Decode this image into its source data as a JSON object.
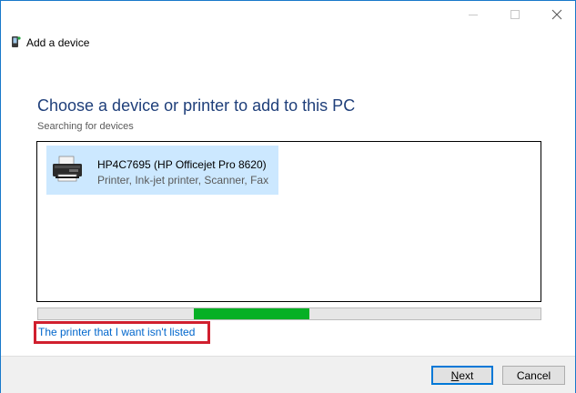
{
  "window": {
    "title": "Add a device",
    "frame_color": "#1979ca"
  },
  "titlebar": {
    "minimize_icon": "minimize-icon",
    "maximize_icon": "maximize-icon",
    "close_icon": "close-icon"
  },
  "main": {
    "heading": "Choose a device or printer to add to this PC",
    "status": "Searching for devices",
    "devices": [
      {
        "name": "HP4C7695 (HP Officejet Pro 8620)",
        "description": "Printer, Ink-jet printer, Scanner, Fax",
        "icon": "printer-icon",
        "selected_color": "#cce8ff"
      }
    ],
    "progress": {
      "type": "marquee",
      "color": "#06b025"
    },
    "not_listed_link": "The printer that I want isn't listed",
    "highlight_color": "#d01f2e"
  },
  "footer": {
    "next_first": "N",
    "next_rest": "ext",
    "cancel_label": "Cancel"
  }
}
